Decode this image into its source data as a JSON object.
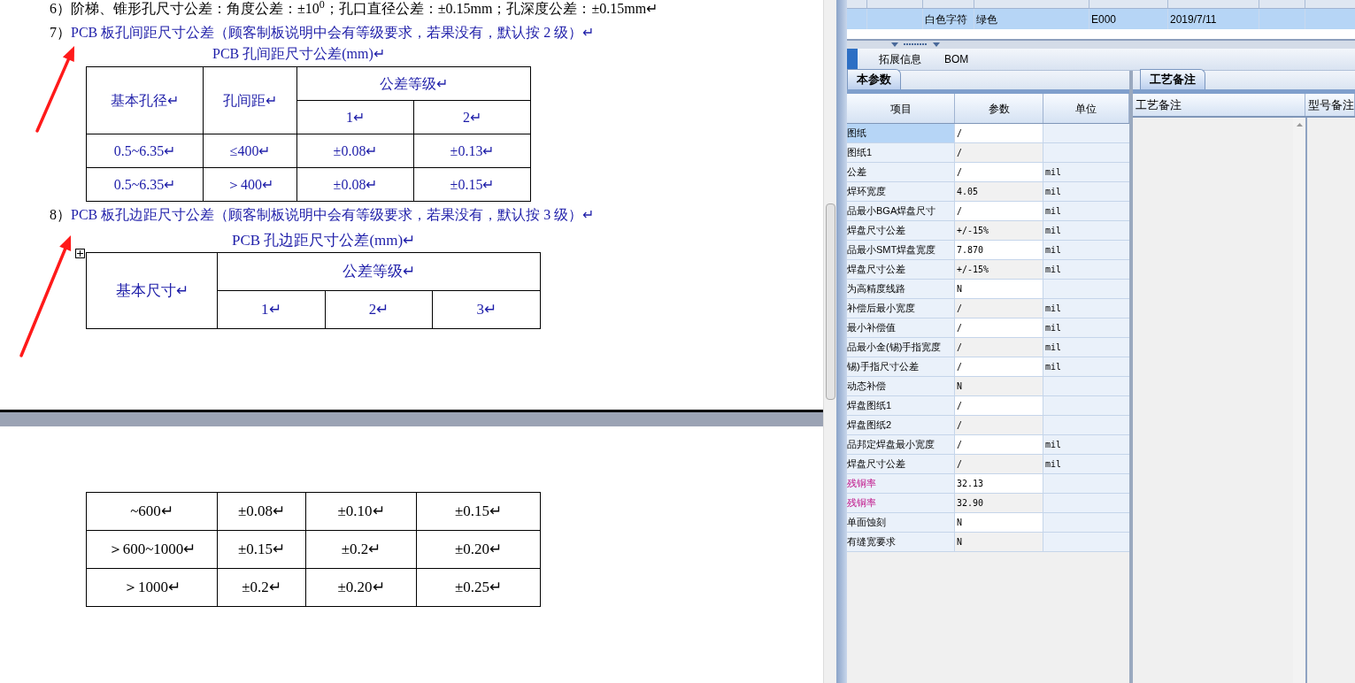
{
  "document": {
    "item_6": "6）阶梯、锥形孔尺寸公差：角度公差：±10$^{0}$；孔口直径公差：±0.15mm；孔深度公差：±0.15mm↵",
    "item_7": {
      "number": "7）",
      "text": "PCB 板孔间距尺寸公差（顾客制板说明中会有等级要求，若果没有，默认按 2 级）↵"
    },
    "table_1": {
      "title": "PCB 孔间距尺寸公差(mm)↵",
      "header": [
        "基本孔径↵",
        "孔间距↵",
        "公差等级↵"
      ],
      "grades": [
        "1↵",
        "2↵"
      ],
      "rows": [
        [
          "0.5~6.35↵",
          "≤400↵",
          "±0.08↵",
          "±0.13↵"
        ],
        [
          "0.5~6.35↵",
          "＞400↵",
          "±0.08↵",
          "±0.15↵"
        ]
      ]
    },
    "item_8": {
      "number": "8）",
      "text": "PCB 板孔边距尺寸公差（顾客制板说明中会有等级要求，若果没有，默认按 3 级）↵"
    },
    "table_2": {
      "title": "PCB 孔边距尺寸公差(mm)↵",
      "header": [
        "基本尺寸↵",
        "公差等级↵"
      ],
      "grades": [
        "1↵",
        "2↵",
        "3↵"
      ]
    },
    "table_3": {
      "rows": [
        [
          "~600↵",
          "±0.08↵",
          "±0.10↵",
          "±0.15↵"
        ],
        [
          "＞600~1000↵",
          "±0.15↵",
          "±0.2↵",
          "±0.20↵"
        ],
        [
          "＞1000↵",
          "±0.2↵",
          "±0.20↵",
          "±0.25↵"
        ]
      ]
    }
  },
  "app": {
    "top_table": {
      "rows": [
        {
          "selected": true,
          "cells": [
            "",
            "",
            "白色字符",
            "绿色",
            "E000",
            "2019/7/11",
            ""
          ]
        }
      ]
    },
    "tabs": [
      {
        "label": "拓展信息",
        "selected": false
      },
      {
        "label": "BOM",
        "selected": false
      }
    ],
    "params_pane": {
      "tab": {
        "label": "本参数",
        "selected": true
      },
      "columns": [
        "项目",
        "参数",
        "单位"
      ],
      "rows": [
        {
          "item": "图纸",
          "value": "/",
          "unit": "",
          "selected": true,
          "emphasized": false
        },
        {
          "item": "图纸1",
          "value": "/",
          "unit": "",
          "selected": false,
          "emphasized": false
        },
        {
          "item": "公差",
          "value": "/",
          "unit": "mil",
          "selected": false,
          "emphasized": false
        },
        {
          "item": "焊环宽度",
          "value": "4.05",
          "unit": "mil",
          "selected": false,
          "emphasized": false
        },
        {
          "item": "品最小BGA焊盘尺寸",
          "value": "/",
          "unit": "mil",
          "selected": false,
          "emphasized": false
        },
        {
          "item": "焊盘尺寸公差",
          "value": "+/-15%",
          "unit": "mil",
          "selected": false,
          "emphasized": false
        },
        {
          "item": "品最小SMT焊盘宽度",
          "value": "7.870",
          "unit": "mil",
          "selected": false,
          "emphasized": false
        },
        {
          "item": "焊盘尺寸公差",
          "value": "+/-15%",
          "unit": "mil",
          "selected": false,
          "emphasized": false
        },
        {
          "item": "为高精度线路",
          "value": "N",
          "unit": "",
          "selected": false,
          "emphasized": false
        },
        {
          "item": "补偿后最小宽度",
          "value": "/",
          "unit": "mil",
          "selected": false,
          "emphasized": false
        },
        {
          "item": "最小补偿值",
          "value": "/",
          "unit": "mil",
          "selected": false,
          "emphasized": false
        },
        {
          "item": "品最小金(锡)手指宽度",
          "value": "/",
          "unit": "mil",
          "selected": false,
          "emphasized": false
        },
        {
          "item": "锡)手指尺寸公差",
          "value": "/",
          "unit": "mil",
          "selected": false,
          "emphasized": false
        },
        {
          "item": "动态补偿",
          "value": "N",
          "unit": "",
          "selected": false,
          "emphasized": false
        },
        {
          "item": "焊盘图纸1",
          "value": "/",
          "unit": "",
          "selected": false,
          "emphasized": false
        },
        {
          "item": "焊盘图纸2",
          "value": "/",
          "unit": "",
          "selected": false,
          "emphasized": false
        },
        {
          "item": "品邦定焊盘最小宽度",
          "value": "/",
          "unit": "mil",
          "selected": false,
          "emphasized": false
        },
        {
          "item": "焊盘尺寸公差",
          "value": "/",
          "unit": "mil",
          "selected": false,
          "emphasized": false
        },
        {
          "item": "残铜率",
          "value": "32.13",
          "unit": "",
          "selected": false,
          "emphasized": true
        },
        {
          "item": "残铜率",
          "value": "32.90",
          "unit": "",
          "selected": false,
          "emphasized": true
        },
        {
          "item": "单面蚀刻",
          "value": "N",
          "unit": "",
          "selected": false,
          "emphasized": false
        },
        {
          "item": "有缝宽要求",
          "value": "N",
          "unit": "",
          "selected": false,
          "emphasized": false
        }
      ]
    },
    "notes_pane": {
      "tab": {
        "label": "工艺备注",
        "selected": true
      },
      "columns": [
        "工艺备注",
        "型号备注"
      ]
    }
  }
}
